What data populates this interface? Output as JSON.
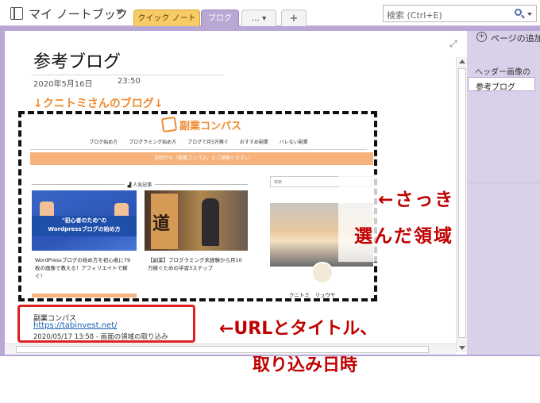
{
  "app": {
    "notebook_title": "マイ ノートブック",
    "tabs": {
      "quick": "クイック ノート",
      "blog": "ブログ",
      "more": "…  ▾",
      "add": "+"
    },
    "search_placeholder": "検索 (Ctrl+E)"
  },
  "page": {
    "title": "参考ブログ",
    "date": "2020年5月16日",
    "time": "23:50",
    "heading": "↓クニトミさんのブログ↓"
  },
  "website": {
    "logo": "副業コンパス",
    "nav": [
      "ブログ始め方",
      "プログラミング始め方",
      "ブログで月5万稼ぐ",
      "おすすめ副業",
      "バレない副業"
    ],
    "banner": "次回から「副業コンパス」とご検索ください",
    "popular_heading": "人気記事",
    "card1_title_line1": "\"初心者のため\"の",
    "card1_title_line2": "Wordpressブログの始め方",
    "card1_text": "WordPressブログの始め方を初心者に79枚の画像で教える！アフィリエイトで稼ぐ！",
    "card2_sign": "道",
    "card2_text": "【副業】プログラミング未経験から月10万稼ぐための学習3ステップ",
    "sidebar_search": "検索",
    "sidebar_name": "クニトミ　リュウヤ"
  },
  "clip": {
    "site_name": "副業コンパス",
    "url": "https://tabinvest.net/",
    "meta": "2020/05/17 13:58 - 画面の領域の取り込み"
  },
  "annotations": {
    "selection_line1": "←さっき",
    "selection_line2": "選んだ領域",
    "url_line1": "←URLとタイトル、",
    "url_line2": "取り込み日時"
  },
  "right_pane": {
    "add_page": "ページの追加",
    "pages": [
      "ヘッダー画像の",
      "参考ブログ"
    ]
  },
  "colors": {
    "accent_purple": "#b9a8d6",
    "annotation_red": "#c00000",
    "heading_orange": "#f08a30"
  }
}
